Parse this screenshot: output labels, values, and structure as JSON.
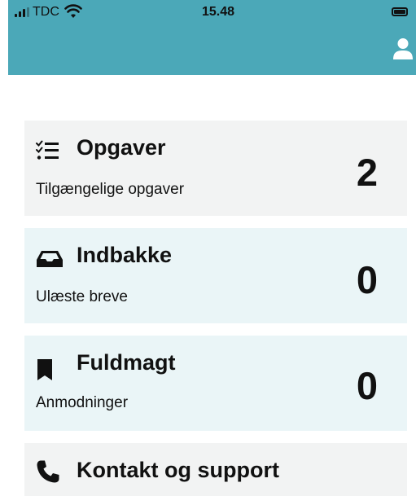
{
  "status_bar": {
    "carrier": "TDC",
    "time": "15.48"
  },
  "header": {
    "profile_icon": "user-icon",
    "color": "#4ba8b8"
  },
  "cards": [
    {
      "title": "Opgaver",
      "subtitle": "Tilgængelige opgaver",
      "count": "2",
      "icon": "checklist-icon"
    },
    {
      "title": "Indbakke",
      "subtitle": "Ulæste breve",
      "count": "0",
      "icon": "inbox-icon"
    },
    {
      "title": "Fuldmagt",
      "subtitle": "Anmodninger",
      "count": "0",
      "icon": "bookmark-icon"
    },
    {
      "title": "Kontakt og support",
      "icon": "phone-icon"
    }
  ]
}
